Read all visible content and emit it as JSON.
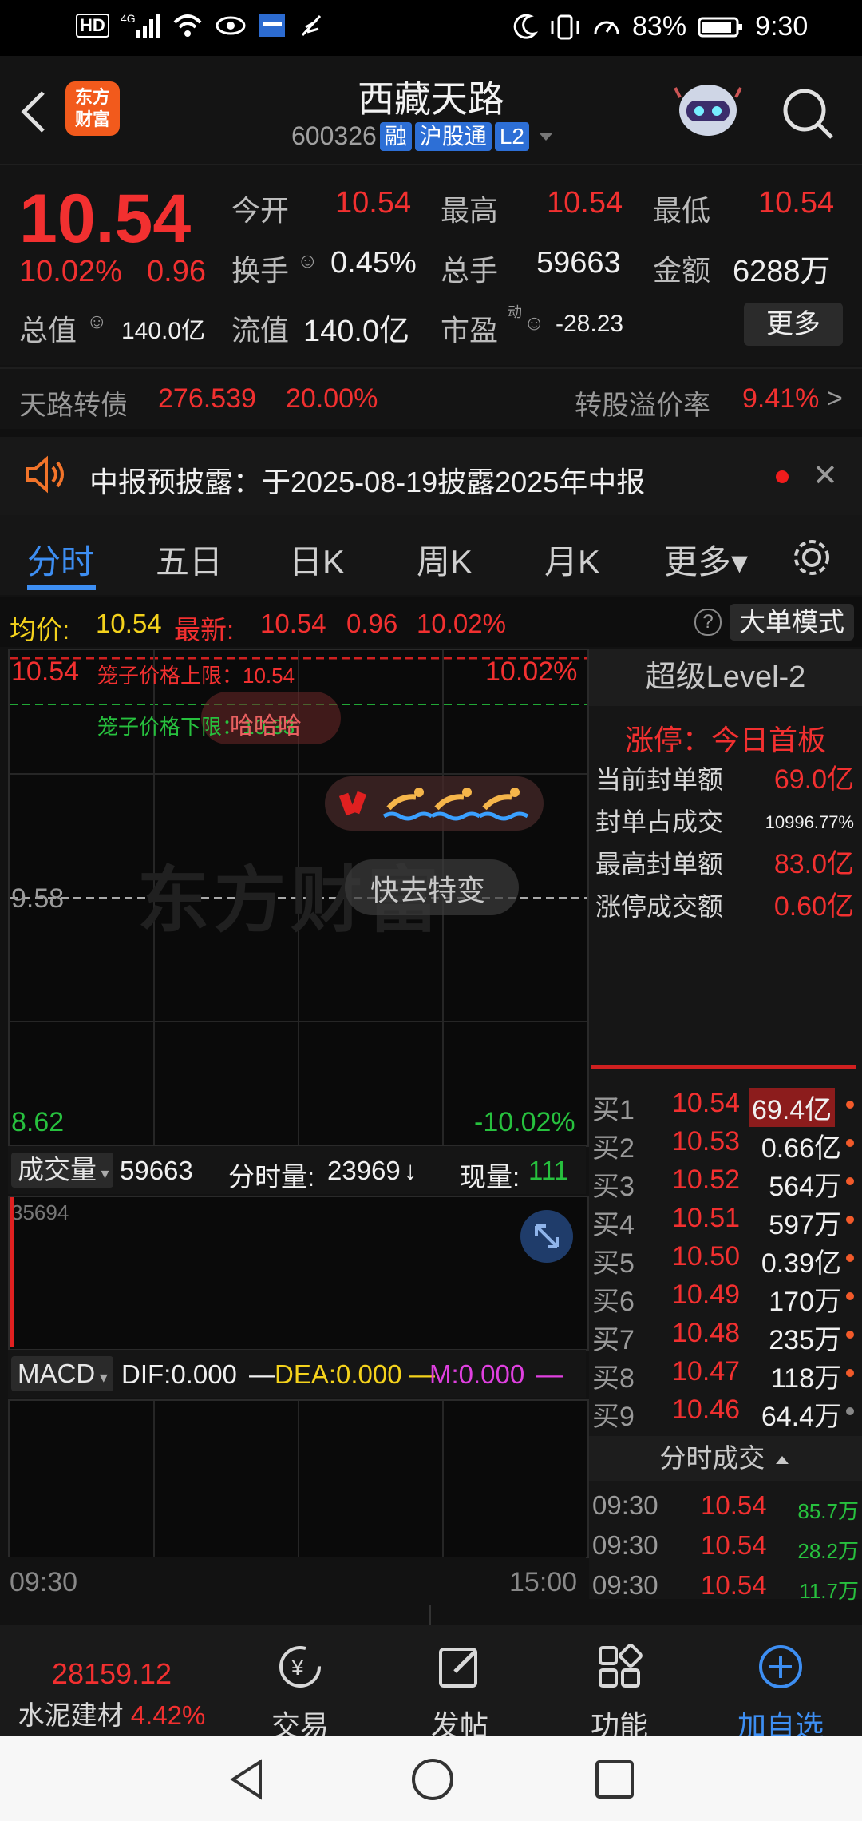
{
  "status_bar": {
    "left_icons": [
      "hd-icon",
      "signal-4g-icon",
      "wifi-icon",
      "eye-icon",
      "card-icon",
      "feather-icon"
    ],
    "battery": "83%",
    "time": "9:30"
  },
  "header": {
    "title": "西藏天路",
    "code": "600326",
    "tag_rong": "融",
    "tag_hugutong": "沪股通",
    "tag_l2": "L2",
    "logo_text_1": "东方",
    "logo_text_2": "财富"
  },
  "quote": {
    "price": "10.54",
    "pct": "10.02%",
    "change": "0.96",
    "open_label": "今开",
    "open": "10.54",
    "high_label": "最高",
    "high": "10.54",
    "low_label": "最低",
    "low": "10.54",
    "turnover_label": "换手",
    "turnover": "0.45%",
    "volume_label": "总手",
    "volume": "59663",
    "amount_label": "金额",
    "amount": "6288万",
    "mktcap_label": "总值",
    "mktcap": "140.0亿",
    "float_label": "流值",
    "float": "140.0亿",
    "pe_label": "市盈",
    "pe_sup": "动",
    "pe": "-28.23",
    "more_btn": "更多"
  },
  "bond": {
    "name": "天路转债",
    "price": "276.539",
    "pct": "20.00%",
    "premium_label": "转股溢价率",
    "premium": "9.41%",
    "arrow": ">"
  },
  "notice": {
    "text": "中报预披露：于2025-08-19披露2025年中报",
    "close": "✕"
  },
  "tabs": [
    "分时",
    "五日",
    "日K",
    "周K",
    "月K",
    "更多▾"
  ],
  "avg_line": {
    "avg_label": "均价:",
    "avg": "10.54",
    "latest_label": "最新:",
    "latest": "10.54",
    "chg": "0.96",
    "pct": "10.02%",
    "help": "?",
    "mode_btn": "大单模式"
  },
  "chart": {
    "top_price": "10.54",
    "top_pct": "10.02%",
    "mid_price": "9.58",
    "bottom_price": "8.62",
    "bottom_pct": "-10.02%",
    "cage_up": "笼子价格上限：10.54",
    "cage_down": "笼子价格下限：10.33",
    "bubble1": "哈哈哈",
    "bubble3": "快去特变",
    "watermark": "东方财富"
  },
  "vol_bar": {
    "selector": "成交量",
    "total": "59663",
    "tick_label": "分时量:",
    "tick": "23969",
    "arrow": "↓",
    "now_label": "现量:",
    "now": "111",
    "vol_max": "35694"
  },
  "macd_bar": {
    "selector": "MACD",
    "dif": "DIF:0.000",
    "dea": "DEA:0.000",
    "m": "M:0.000"
  },
  "time_axis": {
    "start": "09:30",
    "end": "15:00"
  },
  "level2": {
    "title": "超级Level-2",
    "limit_label": "涨停：今日首板",
    "stats": [
      {
        "label": "当前封单额",
        "value": "69.0亿"
      },
      {
        "label": "封单占成交",
        "value": "10996.77%"
      },
      {
        "label": "最高封单额",
        "value": "83.0亿"
      },
      {
        "label": "涨停成交额",
        "value": "0.60亿"
      }
    ],
    "bids": [
      {
        "label": "买1",
        "price": "10.54",
        "vol": "69.4亿"
      },
      {
        "label": "买2",
        "price": "10.53",
        "vol": "0.66亿"
      },
      {
        "label": "买3",
        "price": "10.52",
        "vol": "564万"
      },
      {
        "label": "买4",
        "price": "10.51",
        "vol": "597万"
      },
      {
        "label": "买5",
        "price": "10.50",
        "vol": "0.39亿"
      },
      {
        "label": "买6",
        "price": "10.49",
        "vol": "170万"
      },
      {
        "label": "买7",
        "price": "10.48",
        "vol": "235万"
      },
      {
        "label": "买8",
        "price": "10.47",
        "vol": "118万"
      },
      {
        "label": "买9",
        "price": "10.46",
        "vol": "64.4万"
      }
    ],
    "ticks_title": "分时成交",
    "ticks": [
      {
        "time": "09:30",
        "price": "10.54",
        "vol": "85.7万"
      },
      {
        "time": "09:30",
        "price": "10.54",
        "vol": "28.2万"
      },
      {
        "time": "09:30",
        "price": "10.54",
        "vol": "11.7万"
      }
    ]
  },
  "bottom_nav": {
    "index_value": "28159.12",
    "index_name": "水泥建材",
    "index_pct": "4.42%",
    "trade": "交易",
    "post": "发帖",
    "func": "功能",
    "add": "加自选"
  }
}
